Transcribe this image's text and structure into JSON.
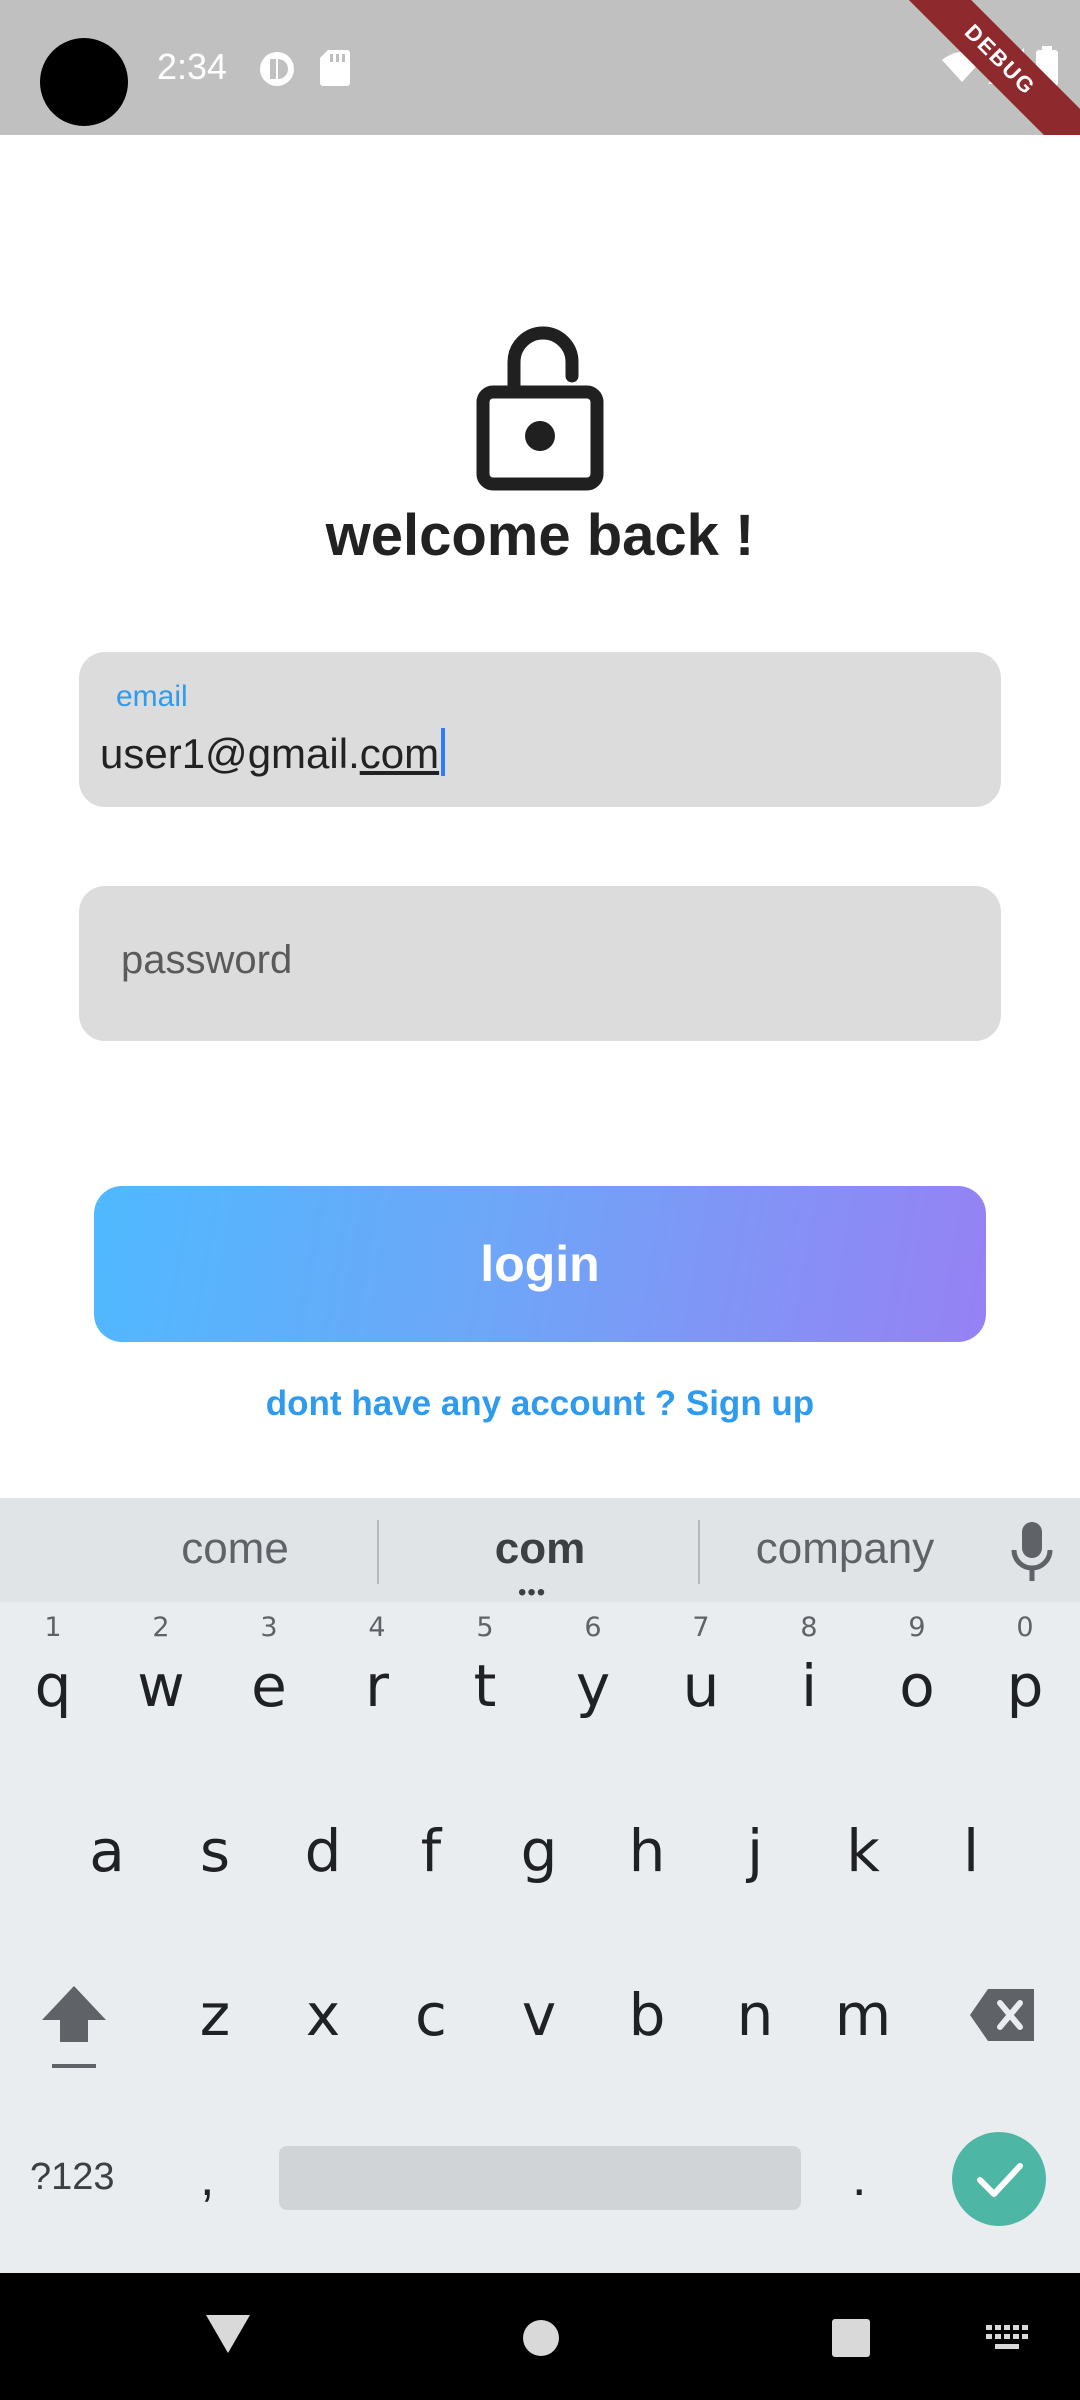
{
  "status_bar": {
    "time": "2:34",
    "debug_label": "DEBUG"
  },
  "screen": {
    "title": "welcome back !"
  },
  "form": {
    "email": {
      "label": "email",
      "value_prefix": "user1@gmail.",
      "value_composing": "com"
    },
    "password": {
      "placeholder": "password"
    },
    "login_label": "login",
    "signup_text": "dont have any account ? Sign up"
  },
  "keyboard": {
    "suggestions": [
      "come",
      "com",
      "company"
    ],
    "rows": [
      [
        {
          "k": "q",
          "h": "1"
        },
        {
          "k": "w",
          "h": "2"
        },
        {
          "k": "e",
          "h": "3"
        },
        {
          "k": "r",
          "h": "4"
        },
        {
          "k": "t",
          "h": "5"
        },
        {
          "k": "y",
          "h": "6"
        },
        {
          "k": "u",
          "h": "7"
        },
        {
          "k": "i",
          "h": "8"
        },
        {
          "k": "o",
          "h": "9"
        },
        {
          "k": "p",
          "h": "0"
        }
      ],
      [
        {
          "k": "a"
        },
        {
          "k": "s"
        },
        {
          "k": "d"
        },
        {
          "k": "f"
        },
        {
          "k": "g"
        },
        {
          "k": "h"
        },
        {
          "k": "j"
        },
        {
          "k": "k"
        },
        {
          "k": "l"
        }
      ],
      [
        {
          "k": "z"
        },
        {
          "k": "x"
        },
        {
          "k": "c"
        },
        {
          "k": "v"
        },
        {
          "k": "b"
        },
        {
          "k": "n"
        },
        {
          "k": "m"
        }
      ]
    ],
    "symbols_label": "?123",
    "comma": ",",
    "period": "."
  },
  "colors": {
    "accent": "#2e9bef",
    "button_gradient_start": "#4fb9ff",
    "button_gradient_end": "#9681f4",
    "enter_key": "#4db6a4"
  },
  "icons": {
    "lock": "lock-open-icon",
    "mic": "microphone-icon",
    "shift": "shift-icon",
    "backspace": "backspace-icon",
    "enter": "check-icon"
  }
}
